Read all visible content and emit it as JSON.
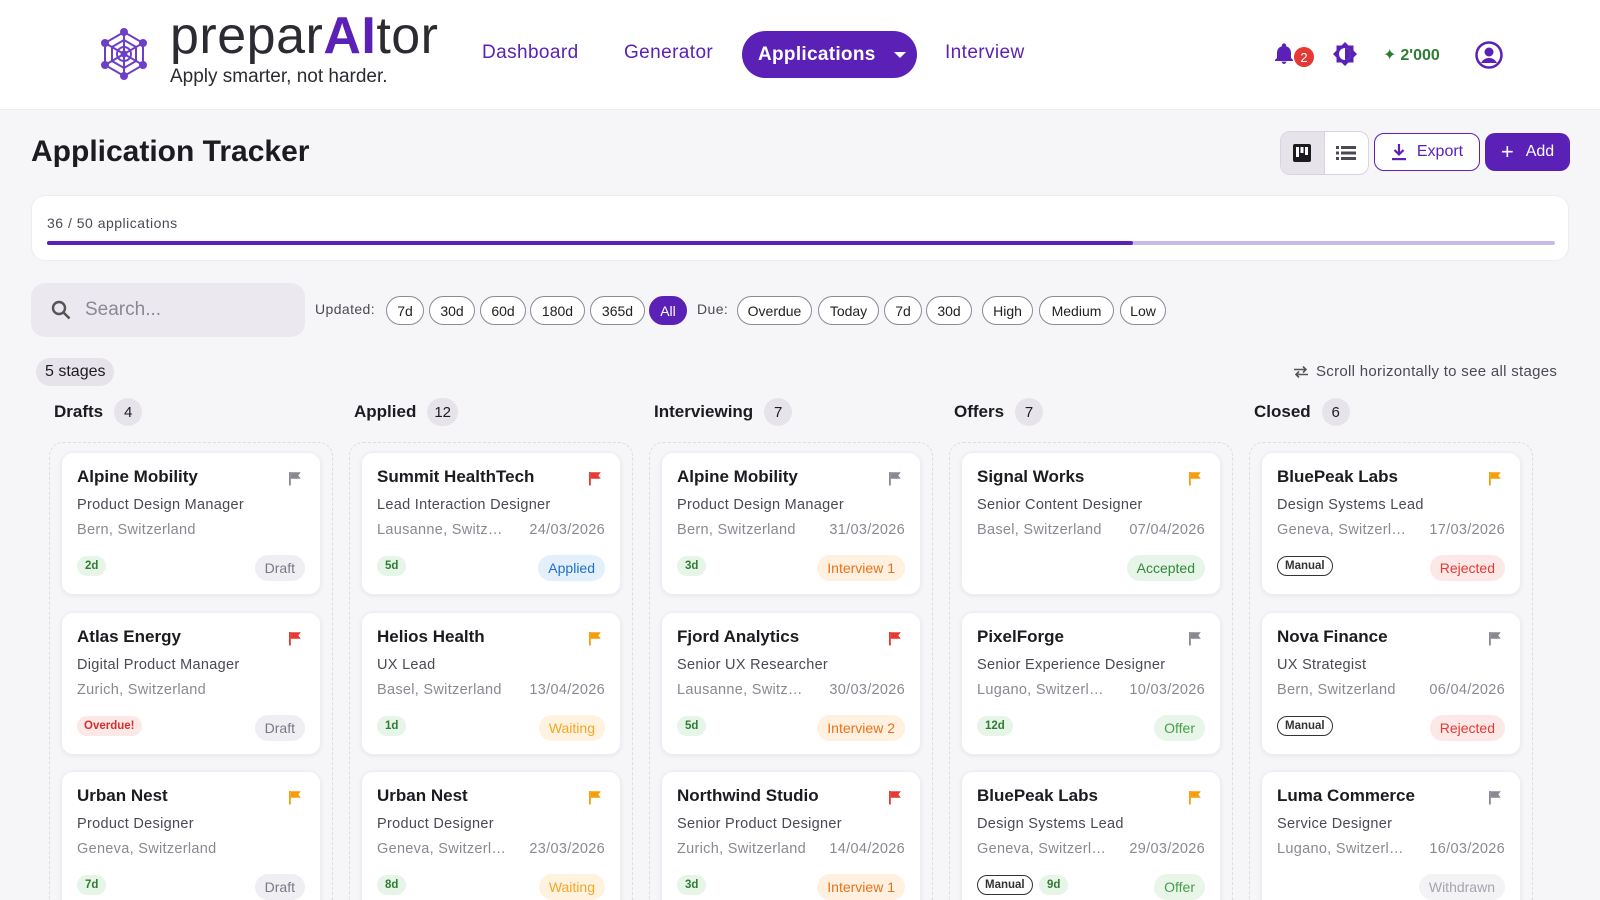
{
  "brand": {
    "prefix": "prepar",
    "ai": "AI",
    "suffix": "tor",
    "tagline": "Apply smarter, not harder."
  },
  "nav": {
    "items": [
      "Dashboard",
      "Generator",
      "Applications",
      "Interview"
    ],
    "active": "Applications"
  },
  "header": {
    "notifications": "2",
    "credits": "2'000",
    "icons": [
      "bell-icon",
      "theme-icon",
      "sparkle-icon",
      "account-icon"
    ]
  },
  "page": {
    "title": "Application Tracker",
    "export_label": "Export",
    "add_label": "Add"
  },
  "progress": {
    "label": "36 / 50 applications",
    "value": 36,
    "total": 50
  },
  "filters": {
    "search_placeholder": "Search...",
    "updated_label": "Updated:",
    "updated_options": [
      "7d",
      "30d",
      "60d",
      "180d",
      "365d",
      "All"
    ],
    "updated_selected": "All",
    "due_label": "Due:",
    "due_options": [
      "Overdue",
      "Today",
      "7d",
      "30d"
    ],
    "priority_options": [
      "High",
      "Medium",
      "Low"
    ]
  },
  "board": {
    "stages_label": "5 stages",
    "scroll_hint": "Scroll horizontally to see all stages",
    "columns": [
      {
        "name": "Drafts",
        "count": "4",
        "cards": [
          {
            "company": "Alpine Mobility",
            "role": "Product Design Manager",
            "location": "Bern, Switzerland",
            "date": "",
            "age": "2d",
            "tag": "",
            "status": "Draft",
            "status_kind": "draft",
            "flag": "#8a8893"
          },
          {
            "company": "Atlas Energy",
            "role": "Digital Product Manager",
            "location": "Zurich, Switzerland",
            "date": "",
            "age": "",
            "tag": "Overdue!",
            "status": "Draft",
            "status_kind": "draft",
            "flag": "#e53935"
          },
          {
            "company": "Urban Nest",
            "role": "Product Designer",
            "location": "Geneva, Switzerland",
            "date": "",
            "age": "7d",
            "tag": "",
            "status": "Draft",
            "status_kind": "draft",
            "flag": "#f59e0b"
          }
        ]
      },
      {
        "name": "Applied",
        "count": "12",
        "cards": [
          {
            "company": "Summit HealthTech",
            "role": "Lead Interaction Designer",
            "location": "Lausanne, Switzer...",
            "date": "24/03/2026",
            "age": "5d",
            "tag": "",
            "status": "Applied",
            "status_kind": "applied",
            "flag": "#e53935"
          },
          {
            "company": "Helios Health",
            "role": "UX Lead",
            "location": "Basel, Switzerland",
            "date": "13/04/2026",
            "age": "1d",
            "tag": "",
            "status": "Waiting",
            "status_kind": "waiting",
            "flag": "#f59e0b"
          },
          {
            "company": "Urban Nest",
            "role": "Product Designer",
            "location": "Geneva, Switzerla...",
            "date": "23/03/2026",
            "age": "8d",
            "tag": "",
            "status": "Waiting",
            "status_kind": "waiting",
            "flag": "#f59e0b"
          }
        ]
      },
      {
        "name": "Interviewing",
        "count": "7",
        "cards": [
          {
            "company": "Alpine Mobility",
            "role": "Product Design Manager",
            "location": "Bern, Switzerland",
            "date": "31/03/2026",
            "age": "3d",
            "tag": "",
            "status": "Interview 1",
            "status_kind": "interview",
            "flag": "#8a8893"
          },
          {
            "company": "Fjord Analytics",
            "role": "Senior UX Researcher",
            "location": "Lausanne, Switzer...",
            "date": "30/03/2026",
            "age": "5d",
            "tag": "",
            "status": "Interview 2",
            "status_kind": "interview",
            "flag": "#e53935"
          },
          {
            "company": "Northwind Studio",
            "role": "Senior Product Designer",
            "location": "Zurich, Switzerland",
            "date": "14/04/2026",
            "age": "3d",
            "tag": "",
            "status": "Interview 1",
            "status_kind": "interview",
            "flag": "#e53935"
          }
        ]
      },
      {
        "name": "Offers",
        "count": "7",
        "cards": [
          {
            "company": "Signal Works",
            "role": "Senior Content Designer",
            "location": "Basel, Switzerland",
            "date": "07/04/2026",
            "age": "",
            "tag": "",
            "status": "Accepted",
            "status_kind": "accepted",
            "flag": "#f59e0b"
          },
          {
            "company": "PixelForge",
            "role": "Senior Experience Designer",
            "location": "Lugano, Switzerla...",
            "date": "10/03/2026",
            "age": "12d",
            "tag": "",
            "status": "Offer",
            "status_kind": "offer",
            "flag": "#8a8893"
          },
          {
            "company": "BluePeak Labs",
            "role": "Design Systems Lead",
            "location": "Geneva, Switzerla...",
            "date": "29/03/2026",
            "age": "9d",
            "tag": "Manual",
            "status": "Offer",
            "status_kind": "offer",
            "flag": "#f59e0b"
          }
        ]
      },
      {
        "name": "Closed",
        "count": "6",
        "cards": [
          {
            "company": "BluePeak Labs",
            "role": "Design Systems Lead",
            "location": "Geneva, Switzerla...",
            "date": "17/03/2026",
            "age": "",
            "tag": "Manual",
            "status": "Rejected",
            "status_kind": "rejected",
            "flag": "#f59e0b"
          },
          {
            "company": "Nova Finance",
            "role": "UX Strategist",
            "location": "Bern, Switzerland",
            "date": "06/04/2026",
            "age": "",
            "tag": "Manual",
            "status": "Rejected",
            "status_kind": "rejected",
            "flag": "#8a8893"
          },
          {
            "company": "Luma Commerce",
            "role": "Service Designer",
            "location": "Lugano, Switzerla...",
            "date": "16/03/2026",
            "age": "",
            "tag": "",
            "status": "Withdrawn",
            "status_kind": "withdrawn",
            "flag": "#8a8893"
          }
        ]
      }
    ]
  },
  "colors": {
    "accent": "#5b21b6",
    "progress_track": "#c9b8e8"
  }
}
